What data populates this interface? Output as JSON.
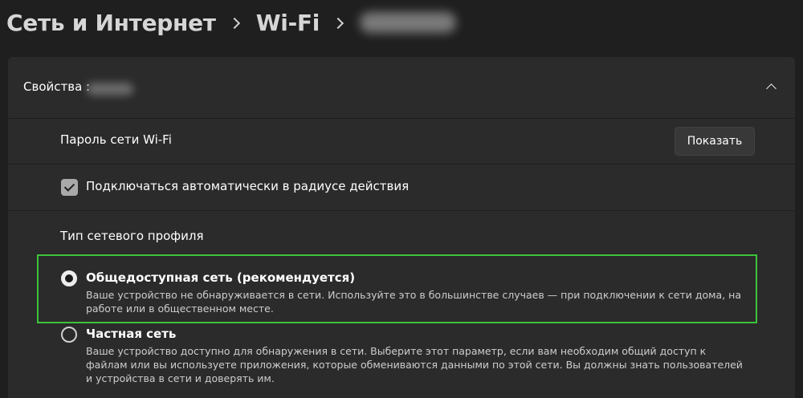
{
  "breadcrumb": {
    "items": [
      "Сеть и Интернет",
      "Wi-Fi"
    ]
  },
  "properties": {
    "label": "Свойства :"
  },
  "password_row": {
    "label": "Пароль сети Wi-Fi",
    "button_label": "Показать"
  },
  "auto_connect": {
    "label": "Подключаться автоматически в радиусе действия",
    "checked": true
  },
  "profile": {
    "title": "Тип сетевого профиля",
    "options": [
      {
        "title": "Общедоступная сеть (рекомендуется)",
        "description": "Ваше устройство не обнаруживается в сети. Используйте это в большинстве случаев — при подключении к сети дома, на работе или в общественном месте.",
        "selected": true
      },
      {
        "title": "Частная сеть",
        "description": "Ваше устройство доступно для обнаружения в сети. Выберите этот параметр, если вам необходим общий доступ к файлам или вы используете приложения, которые обмениваются данными по этой сети. Вы должны знать пользователей и устройства в сети и доверять им.",
        "selected": false
      }
    ]
  },
  "colors": {
    "background": "#1f1f1f",
    "card": "#2b2b2b",
    "highlight": "#3cc43c"
  }
}
